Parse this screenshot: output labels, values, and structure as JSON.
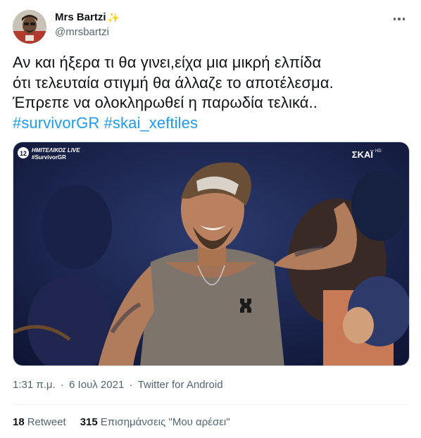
{
  "author": {
    "display_name": "Mrs Bartzi",
    "name_emoji": "sparkles-emoji",
    "handle": "@mrsbartzi"
  },
  "tweet": {
    "lines": [
      "Αν και ήξερα τι θα γινει,είχα μια μικρή ελπίδα",
      "ότι τελευταία στιγμή θα άλλαζε το αποτέλεσμα.",
      "Έπρεπε να ολοκληρωθεί η παρωδία τελικά.."
    ],
    "hashtags": [
      "#survivorGR",
      "#skai_xeftiles"
    ]
  },
  "media": {
    "overlay_top": "ΗΜΙΤΕΛΙΚΟΣ LIVE",
    "overlay_bottom": "#SurvivorGR",
    "channel_badge": "12",
    "channel_logo": "ΣΚΑΪ",
    "channel_logo_suffix": "HD"
  },
  "meta": {
    "time": "1:31 π.μ.",
    "date": "6 Ιουλ 2021",
    "source": "Twitter for Android",
    "separator": "·"
  },
  "stats": {
    "retweets_count": "18",
    "retweets_label": "Retweet",
    "likes_count": "315",
    "likes_label": "Επισημάνσεις \"Μου αρέσει\""
  },
  "colors": {
    "text": "#0f1419",
    "secondary": "#536471",
    "link": "#1d9bf0",
    "divider": "#eff3f4"
  }
}
